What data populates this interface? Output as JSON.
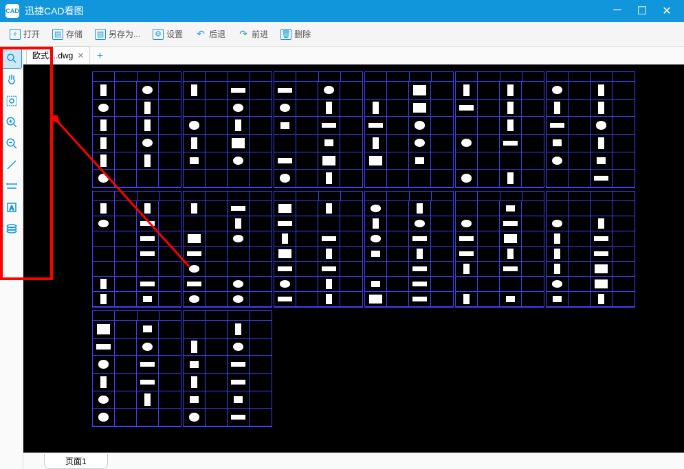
{
  "titlebar": {
    "app_badge": "CAD",
    "title": "迅捷CAD看图"
  },
  "toolbar": {
    "open": "打开",
    "save": "存储",
    "save_as": "另存为...",
    "settings": "设置",
    "back": "后退",
    "forward": "前进",
    "delete": "删除"
  },
  "tabs": {
    "active_name": "欧式....dwg"
  },
  "bottom": {
    "page_label": "页面1"
  },
  "side_tools": [
    {
      "name": "pointer-tool-icon",
      "glyph": "search"
    },
    {
      "name": "pan-tool-icon",
      "glyph": "hand"
    },
    {
      "name": "zoom-extent-icon",
      "glyph": "zoom-box"
    },
    {
      "name": "zoom-in-icon",
      "glyph": "zoom-in"
    },
    {
      "name": "zoom-out-icon",
      "glyph": "zoom-out"
    },
    {
      "name": "edit-tool-icon",
      "glyph": "pencil"
    },
    {
      "name": "measure-tool-icon",
      "glyph": "ruler"
    },
    {
      "name": "text-tool-icon",
      "glyph": "text"
    },
    {
      "name": "layers-tool-icon",
      "glyph": "layers"
    }
  ]
}
